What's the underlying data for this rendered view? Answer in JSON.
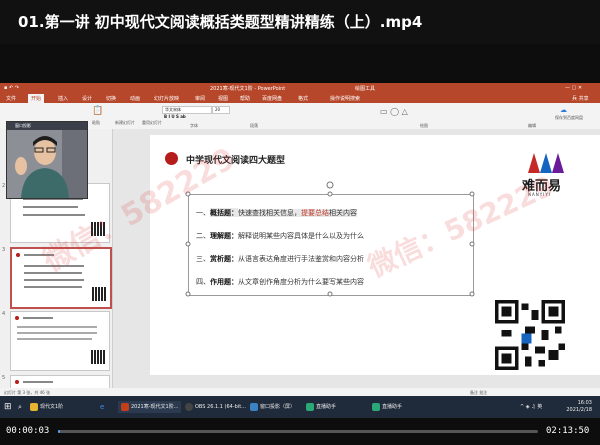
{
  "player": {
    "title": "01.第一讲 初中现代文阅读概括类题型精讲精练（上）.mp4",
    "current_time": "00:00:03",
    "total_time": "02:13:50",
    "progress": 0.0004
  },
  "ppt": {
    "window_title": "2021寒-现代文1阶 - PowerPoint",
    "tool_tab_group": "绘图工具",
    "user": "兵 共享",
    "tabs": [
      "文件",
      "开始",
      "插入",
      "设计",
      "切换",
      "动画",
      "幻灯片放映",
      "审阅",
      "视图",
      "帮助",
      "百度网盘",
      "格式",
      "操作说明搜索"
    ],
    "active_tab": "开始",
    "font_name": "华文宋体",
    "font_size": "20",
    "ribbon_labels": [
      "粘贴",
      "新建幻灯片",
      "重用幻灯片",
      "字体",
      "段落",
      "绘图",
      "编辑",
      "保存到百度网盘"
    ],
    "status_left": "幻灯片 第 3 张，共 46 张",
    "status_right": "备注  批注"
  },
  "webcam": {
    "title": "窗口投影"
  },
  "thumbnails": [
    {
      "num": "2"
    },
    {
      "num": "3"
    },
    {
      "num": "4"
    },
    {
      "num": "5"
    }
  ],
  "slide": {
    "title": "中学现代文阅读四大题型",
    "logo_text": "难而易",
    "logo_sub": "NANYIYI",
    "rows": [
      {
        "num": "一、",
        "type": "概括题：",
        "desc": "快速查找相关信息，",
        "desc2": "提要",
        "desc3": "总结",
        "desc4": "相关内容"
      },
      {
        "num": "二、",
        "type": "理解题：",
        "desc": "解释说明某些内容具体是什么以及为什么"
      },
      {
        "num": "三、",
        "type": "赏析题：",
        "desc": "从语言表达角度进行手法鉴赏和内容分析"
      },
      {
        "num": "四、",
        "type": "作用题：",
        "desc": "从文章创作角度分析为什么要写某些内容"
      }
    ]
  },
  "taskbar": {
    "items": [
      "现代文1阶",
      "2021寒-现代文1阶...",
      "OBS 26.1.1 (64-bit...",
      "窗口投影（屏）",
      "直播助手",
      "直播助手"
    ],
    "clock_time": "16:03",
    "clock_date": "2021/2/18"
  },
  "watermark_text": "微信：582229"
}
